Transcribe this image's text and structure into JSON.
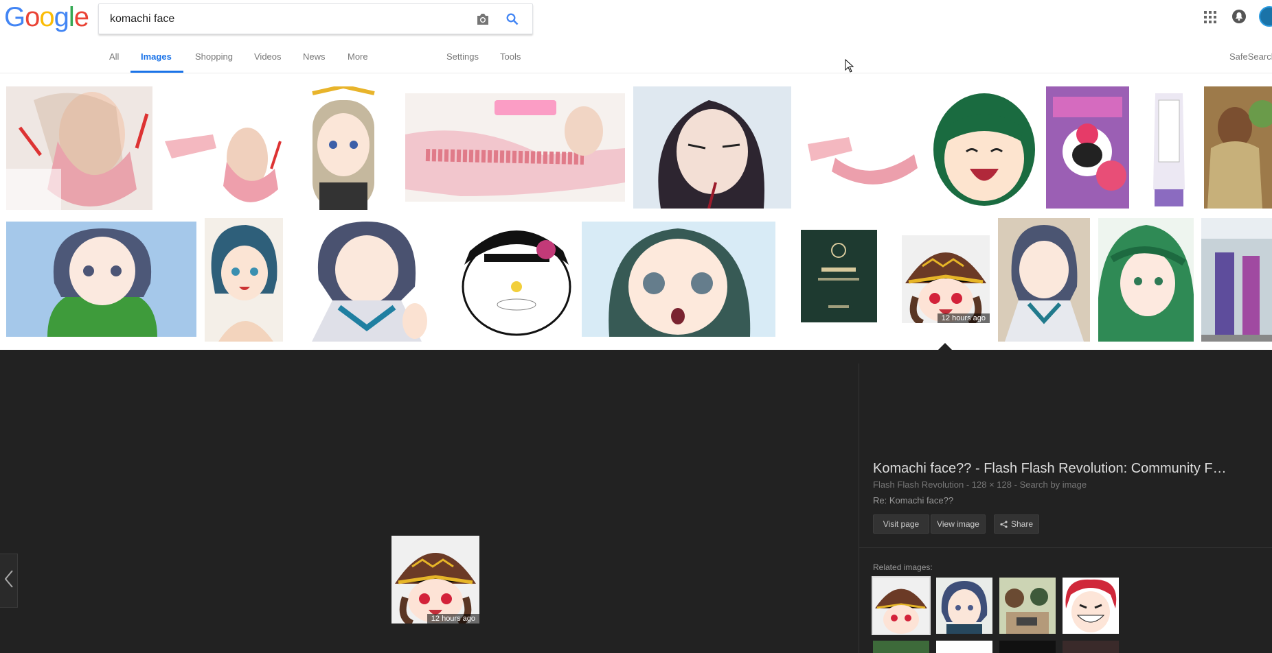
{
  "search": {
    "query": "komachi face"
  },
  "nav": {
    "tabs": [
      "All",
      "Images",
      "Shopping",
      "Videos",
      "News",
      "More"
    ],
    "active": "Images",
    "settings": "Settings",
    "tools": "Tools",
    "safesearch": "SafeSearch"
  },
  "results": {
    "timestamp_badge": "12 hours ago"
  },
  "viewer": {
    "title": "Komachi face?? - Flash Flash Revolution: Community F…",
    "source": "Flash Flash Revolution",
    "separator": " - ",
    "dimensions": "128 × 128",
    "search_by_image": "Search by image",
    "description": "Re: Komachi face??",
    "visit_page": "Visit page",
    "view_image": "View image",
    "share": "Share",
    "related_label": "Related images:",
    "badge": "12 hours ago"
  },
  "icons": {
    "camera": "camera-icon",
    "search": "search-icon",
    "apps": "apps-grid-icon",
    "notifications": "bell-icon",
    "share": "share-icon",
    "prev": "chevron-left-icon"
  },
  "colors": {
    "accent": "#1a73e8",
    "viewer_bg": "#222222"
  }
}
